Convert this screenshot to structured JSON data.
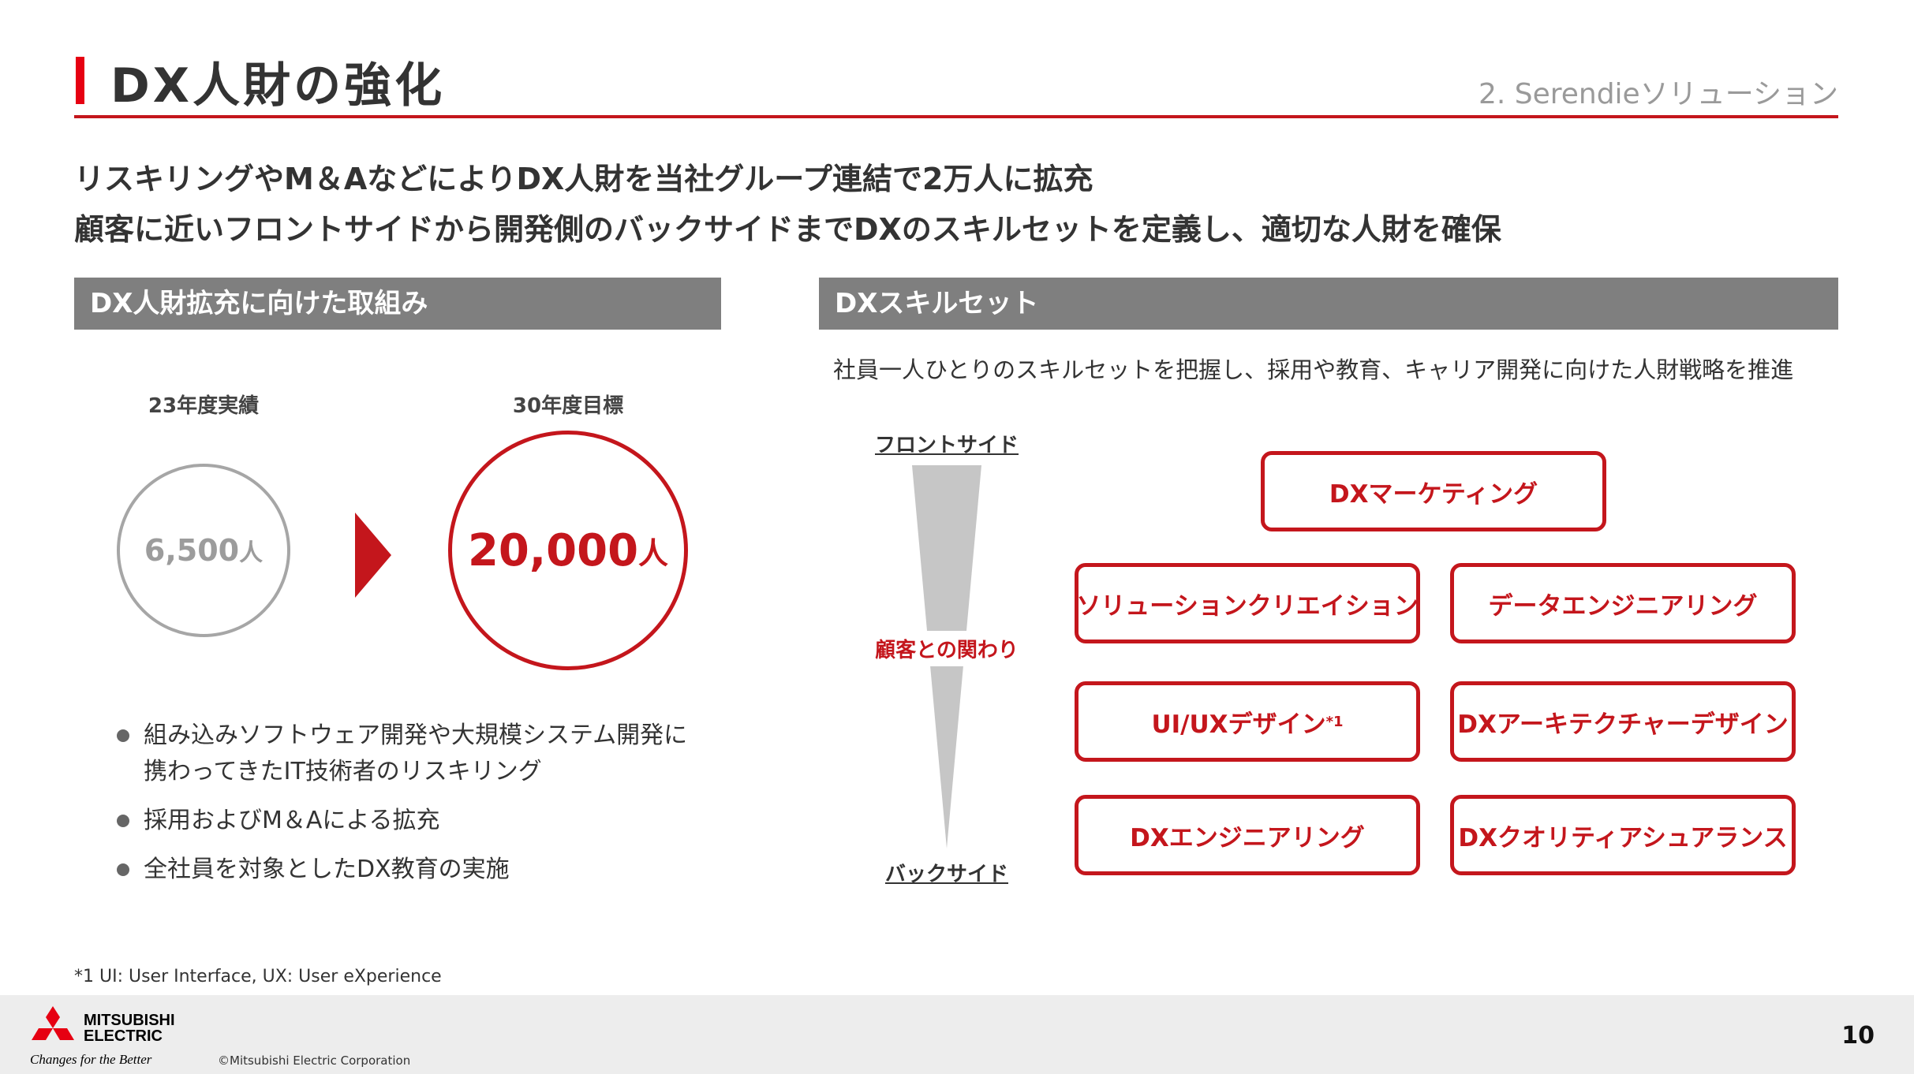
{
  "header": {
    "title": "DX人財の強化",
    "section": "2. Serendieソリューション"
  },
  "lead": {
    "line1": "リスキリングやM＆AなどによりDX人財を当社グループ連結で2万人に拡充",
    "line2": "顧客に近いフロントサイドから開発側のバックサイドまでDXのスキルセットを定義し、適切な人財を確保"
  },
  "left_section": {
    "heading": "DX人財拡充に向けた取組み",
    "current": {
      "label": "23年度実績",
      "value": "6,500",
      "unit": "人"
    },
    "target": {
      "label": "30年度目標",
      "value": "20,000",
      "unit": "人"
    },
    "bullets": [
      {
        "line1": "組み込みソフトウェア開発や大規模システム開発に",
        "line2": "携わってきたIT技術者のリスキリング"
      },
      {
        "line1": "採用およびM＆Aによる拡充"
      },
      {
        "line1": "全社員を対象としたDX教育の実施"
      }
    ]
  },
  "right_section": {
    "heading": "DXスキルセット",
    "description": "社員一人ひとりのスキルセットを把握し、採用や教育、キャリア開発に向けた人財戦略を推進",
    "axis": {
      "top": "フロントサイド",
      "middle": "顧客との関わり",
      "bottom": "バックサイド"
    },
    "skills": {
      "marketing": "DXマーケティング",
      "solution_creation": "ソリューションクリエイション",
      "data_engineering": "データエンジニアリング",
      "uiux_design": "UI/UXデザイン",
      "uiux_footnote_mark": "*1",
      "architecture_design": "DXアーキテクチャーデザイン",
      "engineering": "DXエンジニアリング",
      "quality_assurance": "DXクオリティアシュアランス"
    }
  },
  "footnote": "*1 UI: User Interface, UX: User eXperience",
  "footer": {
    "logo_line1": "MITSUBISHI",
    "logo_line2": "ELECTRIC",
    "tagline": "Changes for the Better",
    "copyright": "©Mitsubishi Electric Corporation",
    "page_number": "10"
  },
  "colors": {
    "accent_red": "#c4161c",
    "gray_heading": "#7f7f7f",
    "footer_gray": "#ededed"
  }
}
